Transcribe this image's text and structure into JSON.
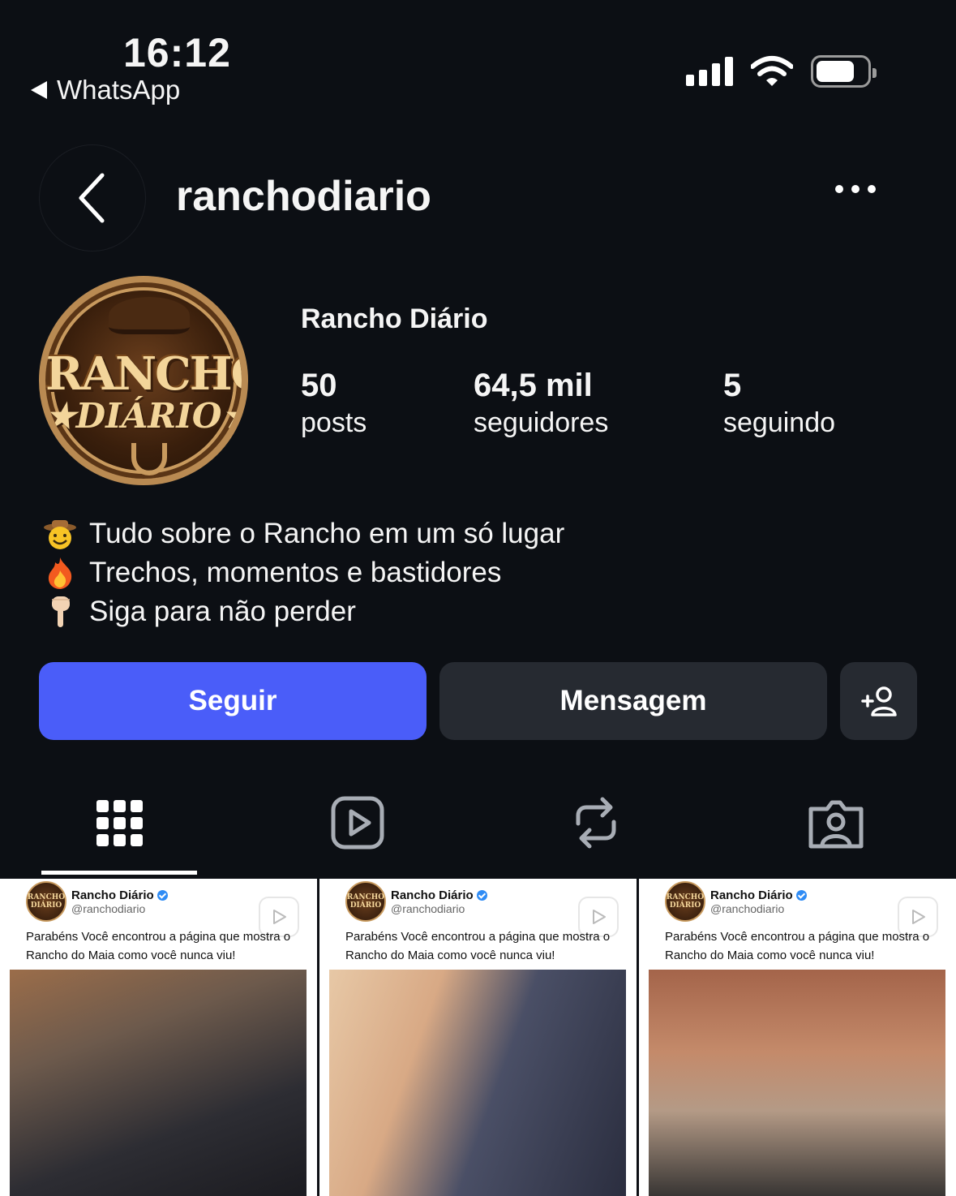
{
  "status_bar": {
    "time": "16:12",
    "back_app": "WhatsApp"
  },
  "header": {
    "username": "ranchodiario"
  },
  "profile": {
    "display_name": "Rancho Diário",
    "avatar_text_1": "RANCHO",
    "avatar_text_2": "★DIÁRIO★",
    "stats": [
      {
        "value": "50",
        "label": "posts"
      },
      {
        "value": "64,5 mil",
        "label": "seguidores"
      },
      {
        "value": "5",
        "label": "seguindo"
      }
    ],
    "bio": [
      {
        "emoji": "cowboy-face",
        "text": "Tudo sobre o Rancho em um só lugar"
      },
      {
        "emoji": "fire",
        "text": "Trechos, momentos e bastidores"
      },
      {
        "emoji": "pointing-down",
        "text": "Siga para não perder"
      }
    ]
  },
  "actions": {
    "follow": "Seguir",
    "message": "Mensagem"
  },
  "tabs": [
    "grid-icon",
    "reels-icon",
    "reposts-icon",
    "tagged-icon"
  ],
  "posts": [
    {
      "name": "Rancho Diário",
      "handle": "@ranchodiario",
      "logo_text": "RANCHO DIÁRIO",
      "text": "Parabéns Você encontrou a página que mostra o Rancho do Maia como você nunca viu!"
    },
    {
      "name": "Rancho Diário",
      "handle": "@ranchodiario",
      "logo_text": "RANCHO DIÁRIO",
      "text": "Parabéns Você encontrou a página que mostra o Rancho do Maia como você nunca viu!"
    },
    {
      "name": "Rancho Diário",
      "handle": "@ranchodiario",
      "logo_text": "RANCHO DIÁRIO",
      "text": "Parabéns Você encontrou a página que mostra o Rancho do Maia como você nunca viu!"
    }
  ],
  "colors": {
    "background": "#0c0f14",
    "follow_button": "#4a5df9",
    "secondary_button": "#262a31",
    "verified": "#2f8cf5"
  }
}
